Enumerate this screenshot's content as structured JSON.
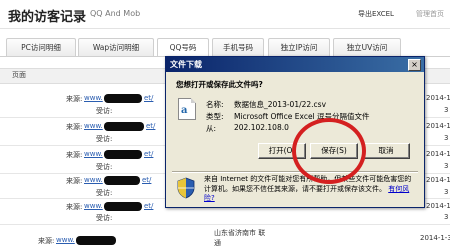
{
  "header": {
    "title": "我的访客记录",
    "subtitle": "QQ And Mob",
    "export_label": "导出EXCEL",
    "admin_label": "管理首页"
  },
  "tabs": [
    {
      "label": "PC访问明细"
    },
    {
      "label": "Wap访问明细"
    },
    {
      "label": "QQ号码"
    },
    {
      "label": "手机号码"
    },
    {
      "label": "独立IP访问"
    },
    {
      "label": "独立UV访问"
    }
  ],
  "table": {
    "header_page": "页面",
    "rows": [
      {
        "source_prefix": "来源:",
        "source_link": "www.",
        "source_suffix": "et/",
        "visit_label": "受访:",
        "date": "2014-1-8",
        "time": "3"
      },
      {
        "source_prefix": "来源:",
        "source_link": "www.",
        "source_suffix": "et/",
        "visit_label": "受访:",
        "date": "2014-1-8",
        "time": "3"
      },
      {
        "source_prefix": "来源:",
        "source_link": "www.",
        "source_suffix": "et/",
        "visit_label": "受访:",
        "date": "2014-1-7",
        "time": "3"
      },
      {
        "source_prefix": "来源:",
        "source_link": "www.",
        "source_suffix": "et/",
        "visit_label": "受访:",
        "date": "2014-1-6",
        "time": "3"
      },
      {
        "source_prefix": "来源:",
        "source_link": "www.",
        "source_suffix": "et/",
        "visit_label": "受访:",
        "date": "2014-1-4",
        "time": "3"
      },
      {
        "source_prefix": "来源:",
        "source_link": "www.",
        "source_suffix": "et/",
        "visit_label": "受访:",
        "date": "2014-1-3",
        "time": "3"
      }
    ],
    "bottom_row": {
      "location": "山东省济南市 联",
      "region": "通",
      "source_prefix": "来源:",
      "source_link": "www.",
      "date": "2014-1-3"
    }
  },
  "dialog": {
    "title": "文件下载",
    "question": "您想打开或保存此文件吗?",
    "name_label": "名称:",
    "name_value": "数据信息_2013-01/22.csv",
    "type_label": "类型:",
    "type_value": "Microsoft Office Excel 逗号分隔值文件",
    "from_label": "从:",
    "from_value": "202.102.108.0",
    "open_button": "打开(O)",
    "save_button": "保存(S)",
    "cancel_button": "取消",
    "close_glyph": "×",
    "warning_text": "来自 Internet 的文件可能对您有所帮助，但某些文件可能危害您的计算机。如果您不信任其来源，请不要打开或保存该文件。",
    "risk_link": "有何风险?"
  },
  "colors": {
    "annotation_circle": "#d42020",
    "titlebar_start": "#0a246a",
    "titlebar_end": "#3a6ea5"
  }
}
